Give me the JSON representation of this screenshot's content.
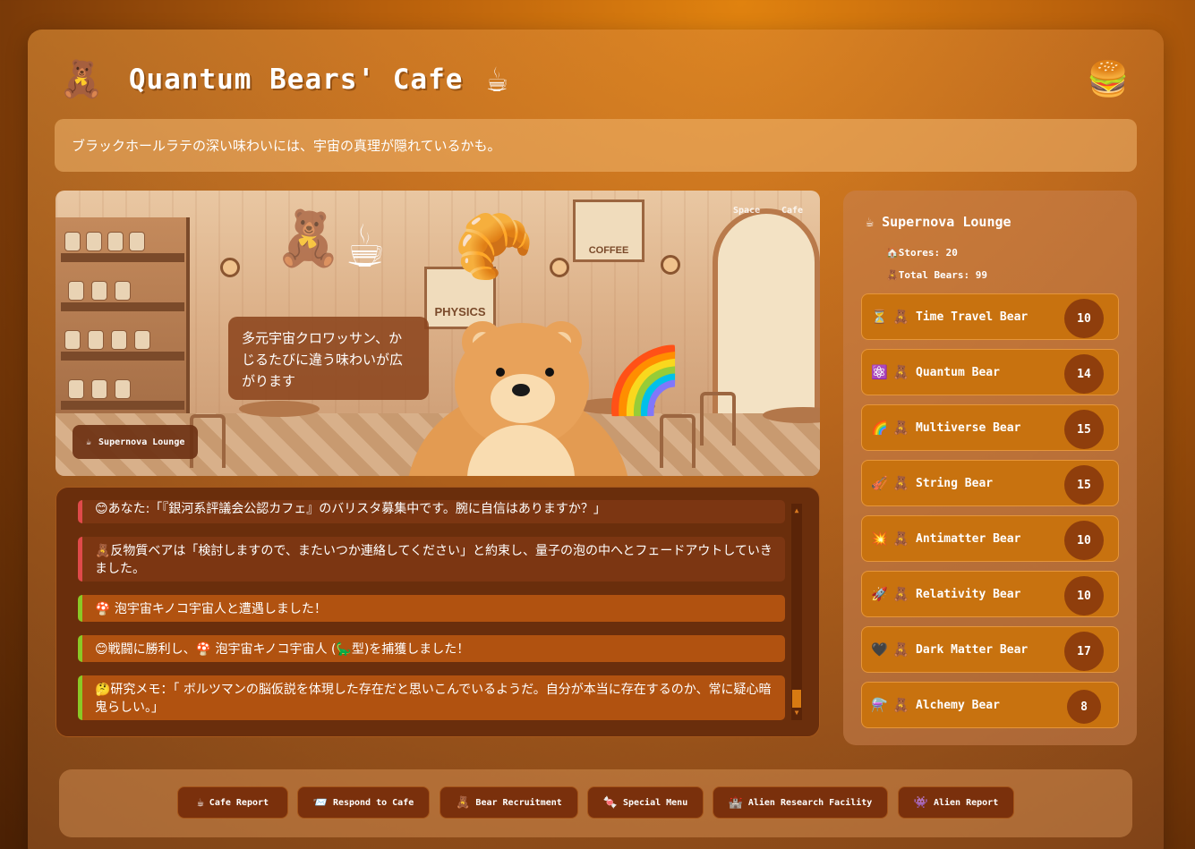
{
  "app": {
    "title": "Quantum Bears' Cafe",
    "title_icon_left": "teddy-bear-icon",
    "title_icon_right": "coffee-cup-icon",
    "menu_icon": "hamburger-icon"
  },
  "quote": "ブラックホールラテの深い味わいには、宇宙の真理が隠れているかも。",
  "scene": {
    "speech": "多元宇宙クロワッサン、かじるたびに違う味わいが広がります",
    "toggle_space": "Space",
    "toggle_cafe": "Cafe",
    "location_icon": "☕",
    "location_label": "Supernova Lounge"
  },
  "log": {
    "entries": [
      {
        "text": "😊あなた:「『銀河系評議会公認カフェ』のバリスタ募集中です。腕に自信はありますか？」",
        "type": "red"
      },
      {
        "text": "🧸反物質ベアは「検討しますので、またいつか連絡してください」と約束し、量子の泡の中へとフェードアウトしていきました。",
        "type": "red"
      },
      {
        "text": "🍄 泡宇宙キノコ宇宙人と遭遇しました！",
        "type": "green"
      },
      {
        "text": "😊戦闘に勝利し、🍄 泡宇宙キノコ宇宙人 (🦕型)を捕獲しました！",
        "type": "green"
      },
      {
        "text": "🤔研究メモ：「 ボルツマンの脳仮説を体現した存在だと思いこんでいるようだ。自分が本当に存在するのか、常に疑心暗鬼らしい。」",
        "type": "green"
      }
    ]
  },
  "sidebar": {
    "title_icon": "☕",
    "title": "Supernova Lounge",
    "stores_icon": "🏠",
    "stores": "Stores: 20",
    "bears_icon": "🧸",
    "total_bears": "Total Bears: 99",
    "bears": [
      {
        "icon": "⏳",
        "name": "Time Travel Bear",
        "count": "10"
      },
      {
        "icon": "⚛️",
        "name": "Quantum Bear",
        "count": "14"
      },
      {
        "icon": "🌈",
        "name": "Multiverse Bear",
        "count": "15"
      },
      {
        "icon": "🎻",
        "name": "String Bear",
        "count": "15"
      },
      {
        "icon": "💥",
        "name": "Antimatter Bear",
        "count": "10"
      },
      {
        "icon": "🚀",
        "name": "Relativity Bear",
        "count": "10"
      },
      {
        "icon": "🖤",
        "name": "Dark Matter Bear",
        "count": "17"
      },
      {
        "icon": "⚗️",
        "name": "Alchemy Bear",
        "count": "8"
      }
    ]
  },
  "actions": [
    {
      "icon": "☕",
      "label": "Cafe Report"
    },
    {
      "icon": "📨",
      "label": "Respond to Cafe"
    },
    {
      "icon": "🧸",
      "label": "Bear Recruitment"
    },
    {
      "icon": "🍬",
      "label": "Special Menu"
    },
    {
      "icon": "🏰",
      "label": "Alien Research Facility"
    },
    {
      "icon": "👾",
      "label": "Alien Report"
    }
  ]
}
